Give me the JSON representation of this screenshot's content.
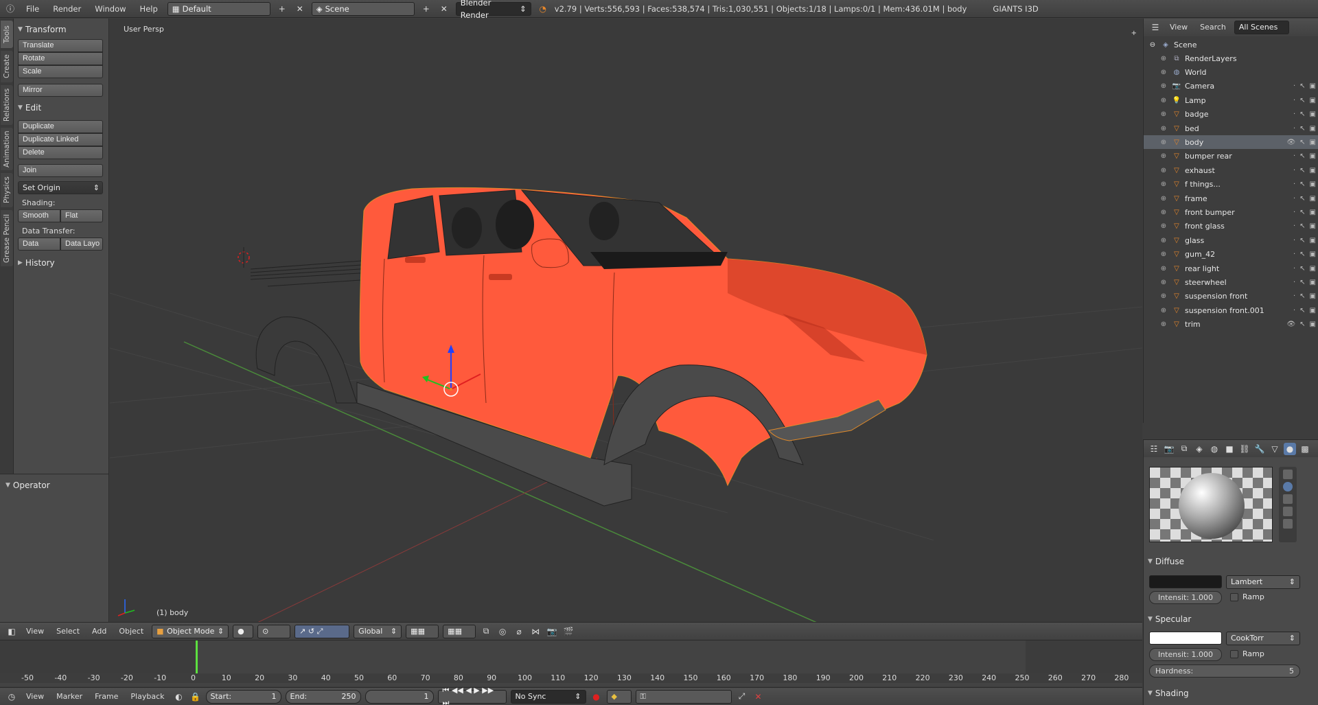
{
  "header": {
    "menus": [
      "File",
      "Render",
      "Window",
      "Help"
    ],
    "layout": "Default",
    "scene": "Scene",
    "engine": "Blender Render",
    "stats": "v2.79 | Verts:556,593 | Faces:538,574 | Tris:1,030,551 | Objects:1/18 | Lamps:0/1 | Mem:436.01M | body",
    "giants": "GIANTS I3D"
  },
  "tabs": [
    "Tools",
    "Create",
    "Relations",
    "Animation",
    "Physics",
    "Grease Pencil"
  ],
  "toolshelf": {
    "transform_title": "Transform",
    "translate": "Translate",
    "rotate": "Rotate",
    "scale": "Scale",
    "mirror": "Mirror",
    "edit_title": "Edit",
    "duplicate": "Duplicate",
    "duplicate_linked": "Duplicate Linked",
    "delete": "Delete",
    "join": "Join",
    "set_origin": "Set Origin",
    "shading_label": "Shading:",
    "smooth": "Smooth",
    "flat": "Flat",
    "data_transfer_label": "Data Transfer:",
    "data": "Data",
    "data_layout": "Data Layo",
    "history_title": "History"
  },
  "operator": {
    "title": "Operator"
  },
  "viewport": {
    "view_name": "User Persp",
    "object_label": "(1) body",
    "body_color": "#ff5a3c"
  },
  "viewport_header": {
    "menus": [
      "View",
      "Select",
      "Add",
      "Object"
    ],
    "mode": "Object Mode",
    "orientation": "Global"
  },
  "timeline": {
    "ticks": [
      "-50",
      "-40",
      "-30",
      "-20",
      "-10",
      "0",
      "10",
      "20",
      "30",
      "40",
      "50",
      "60",
      "70",
      "80",
      "90",
      "100",
      "110",
      "120",
      "130",
      "140",
      "150",
      "160",
      "170",
      "180",
      "190",
      "200",
      "210",
      "220",
      "230",
      "240",
      "250",
      "260",
      "270",
      "280"
    ],
    "menus": [
      "View",
      "Marker",
      "Frame",
      "Playback"
    ],
    "start_label": "Start:",
    "start": "1",
    "end_label": "End:",
    "end": "250",
    "current": "1",
    "sync": "No Sync"
  },
  "outliner": {
    "menus": [
      "View",
      "Search"
    ],
    "filter": "All Scenes",
    "scene": "Scene",
    "items": [
      {
        "name": "RenderLayers",
        "icon": "renderlayers-icon"
      },
      {
        "name": "World",
        "icon": "world-icon"
      },
      {
        "name": "Camera",
        "icon": "camera-icon"
      },
      {
        "name": "Lamp",
        "icon": "lamp-icon"
      },
      {
        "name": "badge",
        "icon": "mesh-icon"
      },
      {
        "name": "bed",
        "icon": "mesh-icon"
      },
      {
        "name": "body",
        "icon": "mesh-icon",
        "selected": true
      },
      {
        "name": "bumper rear",
        "icon": "mesh-icon"
      },
      {
        "name": "exhaust",
        "icon": "mesh-icon"
      },
      {
        "name": "f things...",
        "icon": "mesh-icon"
      },
      {
        "name": "frame",
        "icon": "mesh-icon"
      },
      {
        "name": "front bumper",
        "icon": "mesh-icon"
      },
      {
        "name": "front glass",
        "icon": "mesh-icon"
      },
      {
        "name": "glass",
        "icon": "mesh-icon"
      },
      {
        "name": "gum_42",
        "icon": "mesh-icon"
      },
      {
        "name": "rear light",
        "icon": "mesh-icon"
      },
      {
        "name": "steerwheel",
        "icon": "mesh-icon"
      },
      {
        "name": "suspension front",
        "icon": "mesh-icon"
      },
      {
        "name": "suspension front.001",
        "icon": "mesh-icon"
      },
      {
        "name": "trim",
        "icon": "mesh-icon"
      }
    ]
  },
  "properties": {
    "diffuse_title": "Diffuse",
    "diffuse_shader": "Lambert",
    "diffuse_intensity": "Intensit: 1.000",
    "ramp": "Ramp",
    "specular_title": "Specular",
    "specular_shader": "CookTorr",
    "specular_intensity": "Intensit: 1.000",
    "hardness_label": "Hardness:",
    "hardness": "5",
    "shading_title": "Shading",
    "diffuse_color": "#1a1a1a",
    "specular_color": "#ffffff"
  }
}
